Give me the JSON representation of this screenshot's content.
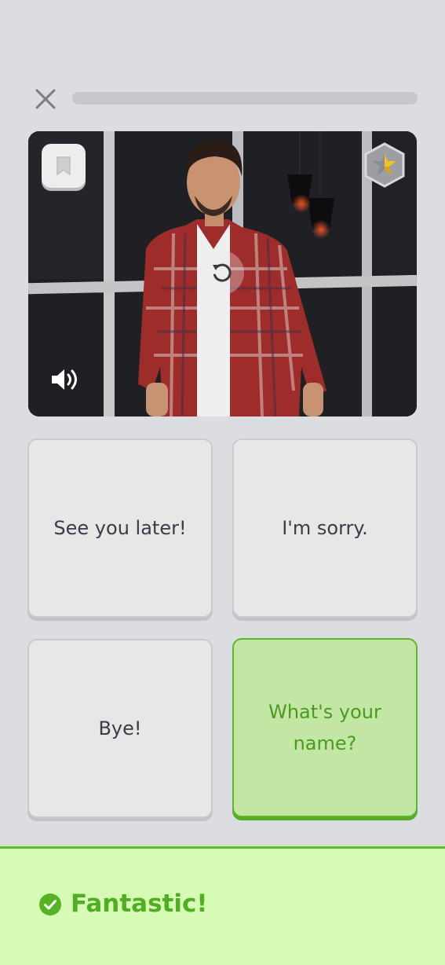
{
  "header": {
    "close_icon": "close-icon",
    "progress": 0.0
  },
  "video": {
    "bookmark_icon": "bookmark-icon",
    "badge_icon": "star-hexagon-badge-icon",
    "replay_icon": "replay-icon",
    "sound_icon": "speaker-icon"
  },
  "answers": [
    {
      "label": "See you later!",
      "selected": false
    },
    {
      "label": "I'm sorry.",
      "selected": false
    },
    {
      "label": "Bye!",
      "selected": false
    },
    {
      "label": "What's your name?",
      "selected": true
    }
  ],
  "feedback": {
    "icon": "check-circle-icon",
    "message": "Fantastic!"
  },
  "colors": {
    "background": "#dcdde0",
    "correct_green": "#5db52a",
    "correct_fill": "#c3e6a5",
    "feedback_bg": "#d6fbb4",
    "text_dark": "#3a3c48"
  }
}
